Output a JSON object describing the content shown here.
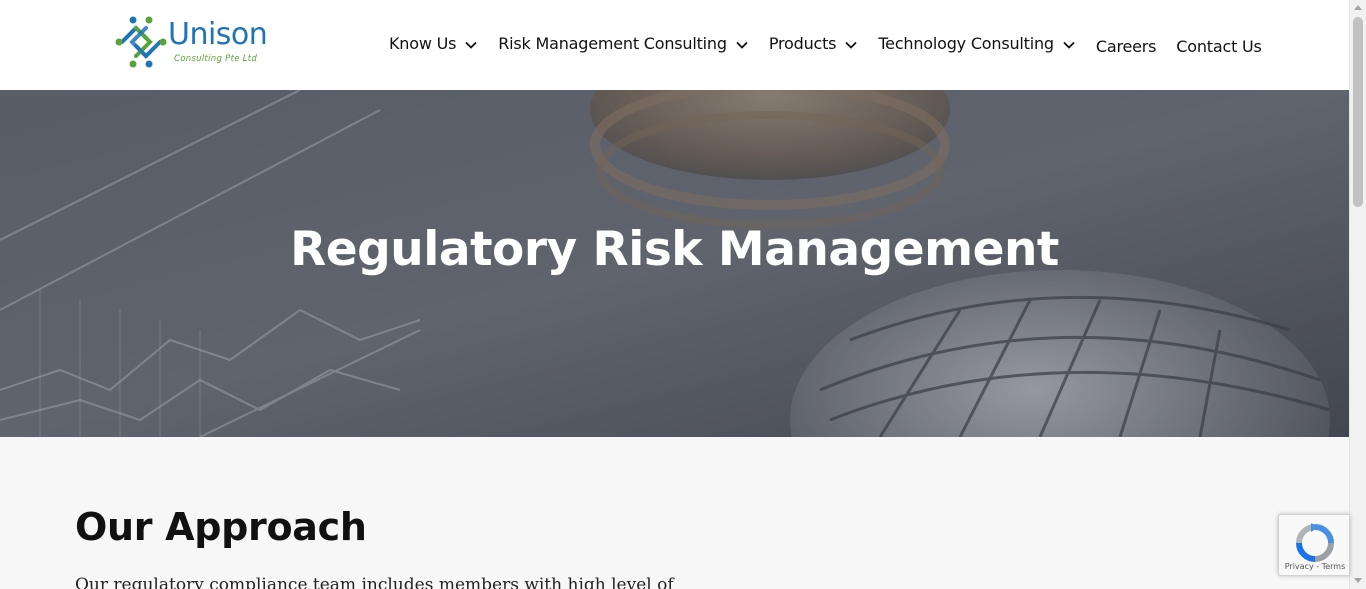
{
  "brand": {
    "name": "Unison",
    "tagline": "Consulting Pte Ltd",
    "colors": {
      "blue": "#1f74b8",
      "green": "#56a43a"
    }
  },
  "nav": {
    "items": [
      {
        "label": "Know Us",
        "has_dropdown": true
      },
      {
        "label": "Risk Management Consulting",
        "has_dropdown": true
      },
      {
        "label": "Products",
        "has_dropdown": true
      },
      {
        "label": "Technology Consulting",
        "has_dropdown": true
      },
      {
        "label": "Careers",
        "has_dropdown": false
      },
      {
        "label": "Contact Us",
        "has_dropdown": false
      }
    ],
    "dropdown_icon": "chevron-down-icon"
  },
  "hero": {
    "title": "Regulatory Risk Management",
    "background_description_icon": "coins-and-globe-background"
  },
  "main": {
    "section_title": "Our Approach",
    "section_text": "Our regulatory compliance team includes members with high level of"
  },
  "recaptcha": {
    "privacy_label": "Privacy",
    "separator": " - ",
    "terms_label": "Terms"
  }
}
